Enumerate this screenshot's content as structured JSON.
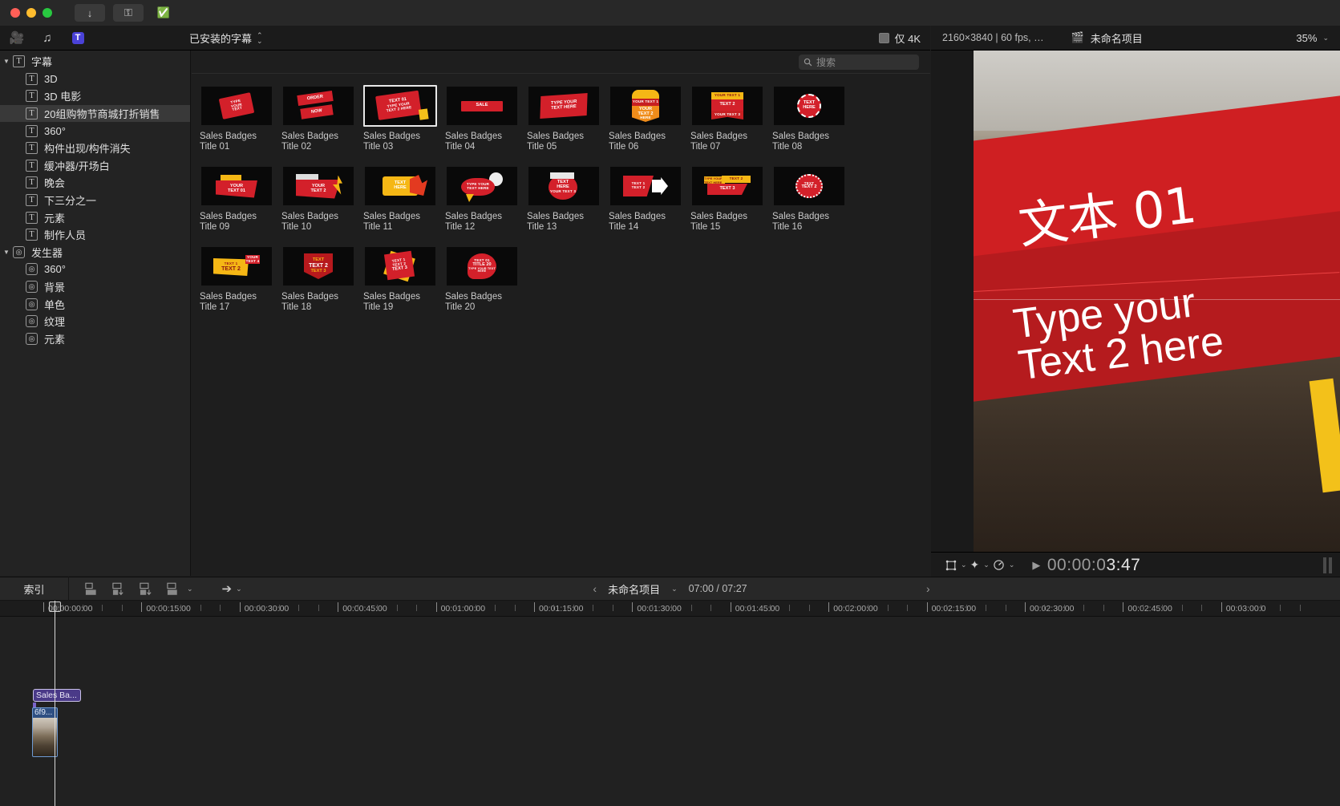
{
  "titlebar": {
    "buttons": [
      {
        "name": "download-button",
        "glyph": "↓"
      },
      {
        "name": "key-button",
        "glyph": "⚷"
      },
      {
        "name": "check-button",
        "glyph": "⊘"
      }
    ]
  },
  "toolbar": {
    "icons": [
      {
        "name": "media-browser-icon",
        "glyph": "🎬"
      },
      {
        "name": "audio-effects-icon",
        "glyph": "♪"
      },
      {
        "name": "titles-generators-icon",
        "glyph": "T"
      }
    ],
    "library_popup": "已安装的字幕",
    "only_4k_label": "仅 4K",
    "only_4k_checked": true
  },
  "search": {
    "placeholder": "搜索",
    "value": "",
    "icon": "search-icon"
  },
  "sidebar": {
    "groups": [
      {
        "label": "字幕",
        "icon": "title-icon",
        "expanded": true,
        "items": [
          {
            "label": "3D",
            "icon": "title-icon",
            "selected": false
          },
          {
            "label": "3D 电影",
            "icon": "title-icon",
            "selected": false
          },
          {
            "label": "20组购物节商城打折销售",
            "icon": "title-icon",
            "selected": true
          },
          {
            "label": "360°",
            "icon": "title-icon",
            "selected": false
          },
          {
            "label": "构件出现/构件消失",
            "icon": "title-icon",
            "selected": false
          },
          {
            "label": "缓冲器/开场白",
            "icon": "title-icon",
            "selected": false
          },
          {
            "label": "晚会",
            "icon": "title-icon",
            "selected": false
          },
          {
            "label": "下三分之一",
            "icon": "title-icon",
            "selected": false
          },
          {
            "label": "元素",
            "icon": "title-icon",
            "selected": false
          },
          {
            "label": "制作人员",
            "icon": "title-icon",
            "selected": false
          }
        ]
      },
      {
        "label": "发生器",
        "icon": "generator-icon",
        "expanded": true,
        "items": [
          {
            "label": "360°",
            "icon": "generator-icon",
            "selected": false
          },
          {
            "label": "背景",
            "icon": "generator-icon",
            "selected": false
          },
          {
            "label": "单色",
            "icon": "generator-icon",
            "selected": false
          },
          {
            "label": "纹理",
            "icon": "generator-icon",
            "selected": false
          },
          {
            "label": "元素",
            "icon": "generator-icon",
            "selected": false
          }
        ]
      }
    ]
  },
  "browser": {
    "items": [
      {
        "label": "Sales Badges Title 01",
        "selected": false,
        "art": "tag-type-your-text",
        "art_lines": [
          "TYPE",
          "YOUR",
          "TEXT"
        ]
      },
      {
        "label": "Sales Badges Title 02",
        "selected": false,
        "art": "ribbon-order-now",
        "art_lines": [
          "ORDER",
          "NOW"
        ]
      },
      {
        "label": "Sales Badges Title 03",
        "selected": true,
        "art": "tag-text01",
        "art_lines": [
          "TEXT 01",
          "TYPE YOUR",
          "TEXT 2 HERE"
        ]
      },
      {
        "label": "Sales Badges Title 04",
        "selected": false,
        "art": "ribbon-sale",
        "art_lines": [
          "SALE"
        ]
      },
      {
        "label": "Sales Badges Title 05",
        "selected": false,
        "art": "banner-type-your-text-here",
        "art_lines": [
          "TYPE YOUR",
          "TEXT HERE"
        ]
      },
      {
        "label": "Sales Badges Title 06",
        "selected": false,
        "art": "shield-your-text",
        "art_lines": [
          "YOUR TEXT 1",
          "YOUR",
          "TEXT 2",
          "HERE"
        ]
      },
      {
        "label": "Sales Badges Title 07",
        "selected": false,
        "art": "burst-ribbon",
        "art_lines": [
          "YOUR TEXT 1",
          "TEXT 2",
          "YOUR TEXT 3"
        ]
      },
      {
        "label": "Sales Badges Title 08",
        "selected": false,
        "art": "seal-text-here",
        "art_lines": [
          "TEXT",
          "HERE"
        ]
      },
      {
        "label": "Sales Badges Title 09",
        "selected": false,
        "art": "speech-your-text-01",
        "art_lines": [
          "YOUR",
          "TEXT 01"
        ]
      },
      {
        "label": "Sales Badges Title 10",
        "selected": false,
        "art": "bolt-your-text-2",
        "art_lines": [
          "TEXT 1",
          "YOUR",
          "TEXT 2"
        ]
      },
      {
        "label": "Sales Badges Title 11",
        "selected": false,
        "art": "flame-text-here",
        "art_lines": [
          "TEXT",
          "HERE"
        ]
      },
      {
        "label": "Sales Badges Title 12",
        "selected": false,
        "art": "bubble-type-your-text-here",
        "art_lines": [
          "TYPE YOUR",
          "TEXT HERE"
        ]
      },
      {
        "label": "Sales Badges Title 13",
        "selected": false,
        "art": "circle-text-here",
        "art_lines": [
          "TYPE YOUR",
          "TEXT",
          "HERE",
          "YOUR TEXT 3"
        ]
      },
      {
        "label": "Sales Badges Title 14",
        "selected": false,
        "art": "arrow-text-1-2",
        "art_lines": [
          "TEXT 1",
          "TEXT 2"
        ]
      },
      {
        "label": "Sales Badges Title 15",
        "selected": false,
        "art": "flag-text-3",
        "art_lines": [
          "TYPE YOUR TEXT HERE",
          "TEXT 2",
          "TEXT 3"
        ]
      },
      {
        "label": "Sales Badges Title 16",
        "selected": false,
        "art": "seal-text-2",
        "art_lines": [
          "TEXT",
          "TEXT 2"
        ]
      },
      {
        "label": "Sales Badges Title 17",
        "selected": false,
        "art": "yellow-text-1-2",
        "art_lines": [
          "TEXT 1",
          "TEXT 2",
          "YOUR TEXT 4"
        ]
      },
      {
        "label": "Sales Badges Title 18",
        "selected": false,
        "art": "shield-text-3",
        "art_lines": [
          "TEXT",
          "TEXT 2",
          "TEXT 3"
        ]
      },
      {
        "label": "Sales Badges Title 19",
        "selected": false,
        "art": "star-text-3",
        "art_lines": [
          "TEXT 1",
          "TEXT 2",
          "TEXT 3"
        ]
      },
      {
        "label": "Sales Badges Title 20",
        "selected": false,
        "art": "bubble-title-20",
        "art_lines": [
          "TEXT 01",
          "TITLE 20",
          "TYPE YOUR TEXT HERE"
        ]
      }
    ]
  },
  "viewer": {
    "meta": "2160×3840 | 60 fps,  …",
    "project_icon": "clapperboard-icon",
    "project_name": "未命名项目",
    "zoom_level": "35%",
    "preview": {
      "text_cn": "文本 01",
      "text_en_line1": "Type your",
      "text_en_line2": "Text 2 here",
      "banner_color": "#cf1f22",
      "accent_color": "#f3c11a"
    }
  },
  "transport": {
    "tools": [
      {
        "name": "transform-icon",
        "glyph": "⬚"
      },
      {
        "name": "enhance-icon",
        "glyph": "✨"
      },
      {
        "name": "color-board-icon",
        "glyph": "◎"
      }
    ],
    "play_icon": "play-icon",
    "timecode_dim": "00:00:0",
    "timecode_bright": "3:47",
    "timecode_full": "00:00:03:47"
  },
  "timeline": {
    "index_label": "索引",
    "tools": [
      {
        "name": "append-icon",
        "glyph": "▣"
      },
      {
        "name": "insert-icon",
        "glyph": "▤"
      },
      {
        "name": "overwrite-icon",
        "glyph": "▥"
      },
      {
        "name": "connect-icon",
        "glyph": "▦"
      },
      {
        "name": "select-tool-icon",
        "glyph": "➚"
      }
    ],
    "prev_label": "‹",
    "next_label": "›",
    "project_name": "未命名项目",
    "duration": "07:00 / 07:27",
    "ruler_labels": [
      "00:00:00:00",
      "00:00:15:00",
      "00:00:30:00",
      "00:00:45:00",
      "00:01:00:00",
      "00:01:15:00",
      "00:01:30:00",
      "00:01:45:00",
      "00:02:00:00",
      "00:02:15:00",
      "00:02:30:00",
      "00:02:45:00",
      "00:03:00:0"
    ],
    "clips": [
      {
        "name": "title-clip",
        "label": "Sales Ba...",
        "color": "#4a3a88"
      },
      {
        "name": "video-clip",
        "label": "6f9...",
        "color": "#2e4f82"
      }
    ]
  }
}
